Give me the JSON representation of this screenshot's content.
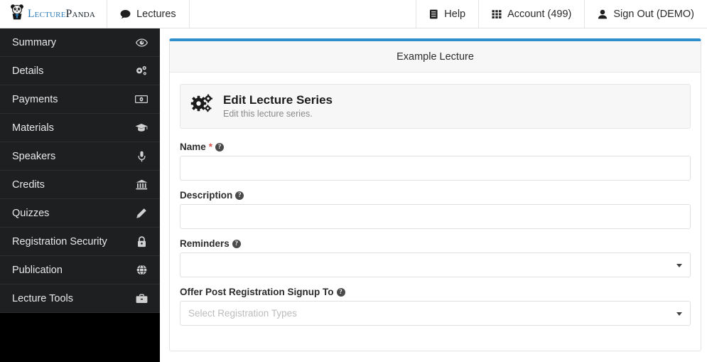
{
  "topnav": {
    "brand": {
      "name_light": "Lecture",
      "name_dark": "Panda",
      "icon": "panda-logo-icon"
    },
    "left_items": [
      {
        "label": "Lectures",
        "icon": "comment-icon"
      }
    ],
    "right_items": [
      {
        "label": "Help",
        "icon": "book-icon"
      },
      {
        "label": "Account (499)",
        "icon": "grid-icon"
      },
      {
        "label": "Sign Out (DEMO)",
        "icon": "user-icon"
      }
    ]
  },
  "sidebar": {
    "items": [
      {
        "label": "Summary",
        "icon": "eye-icon"
      },
      {
        "label": "Details",
        "icon": "cogs-icon"
      },
      {
        "label": "Payments",
        "icon": "money-icon"
      },
      {
        "label": "Materials",
        "icon": "graduation-cap-icon"
      },
      {
        "label": "Speakers",
        "icon": "microphone-icon"
      },
      {
        "label": "Credits",
        "icon": "bank-icon"
      },
      {
        "label": "Quizzes",
        "icon": "pencil-icon"
      },
      {
        "label": "Registration Security",
        "icon": "lock-icon"
      },
      {
        "label": "Publication",
        "icon": "globe-icon"
      },
      {
        "label": "Lecture Tools",
        "icon": "briefcase-icon"
      }
    ]
  },
  "panel": {
    "title": "Example Lecture",
    "accent_color": "#2f8ecb",
    "callout": {
      "icon": "cogs-icon",
      "title": "Edit Lecture Series",
      "subtitle": "Edit this lecture series."
    },
    "fields": [
      {
        "label": "Name",
        "required": true,
        "required_mark": "*",
        "help": "?",
        "type": "text",
        "value": "",
        "placeholder": ""
      },
      {
        "label": "Description",
        "required": false,
        "help": "?",
        "type": "text",
        "value": "",
        "placeholder": ""
      },
      {
        "label": "Reminders",
        "required": false,
        "help": "?",
        "type": "select",
        "value": "",
        "placeholder": ""
      },
      {
        "label": "Offer Post Registration Signup To",
        "required": false,
        "help": "?",
        "type": "select",
        "value": "",
        "placeholder": "Select Registration Types"
      }
    ]
  }
}
